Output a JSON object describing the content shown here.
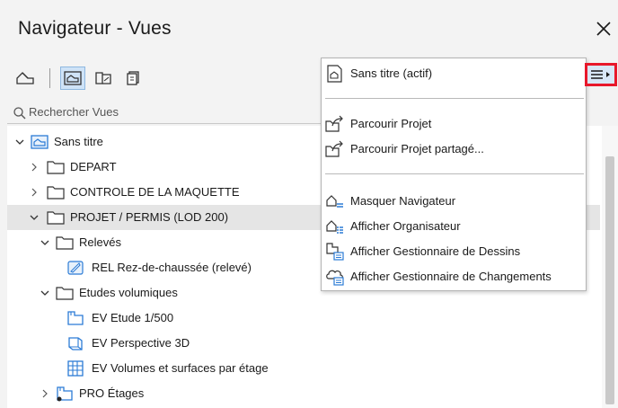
{
  "window": {
    "title": "Navigateur - Vues"
  },
  "search": {
    "placeholder": "Rechercher Vues"
  },
  "tree": [
    {
      "label": "Sans titre",
      "icon": "view-root-icon"
    },
    {
      "label": "DEPART",
      "icon": "folder-icon"
    },
    {
      "label": "CONTROLE DE LA MAQUETTE",
      "icon": "folder-icon"
    },
    {
      "label": "PROJET / PERMIS (LOD 200)",
      "icon": "folder-icon",
      "selected": true
    },
    {
      "label": "Relevés",
      "icon": "folder-icon"
    },
    {
      "label": "REL Rez-de-chaussée (relevé)",
      "icon": "elevation-view-icon"
    },
    {
      "label": "Etudes volumiques",
      "icon": "folder-icon"
    },
    {
      "label": "EV Etude 1/500",
      "icon": "story-view-icon"
    },
    {
      "label": "EV Perspective 3D",
      "icon": "3d-view-icon"
    },
    {
      "label": "EV Volumes et surfaces par étage",
      "icon": "schedule-view-icon"
    },
    {
      "label": "PRO Étages",
      "icon": "story-view-icon"
    }
  ],
  "menu": {
    "items": [
      {
        "label": "Sans titre (actif)",
        "icon": "project-map-icon"
      },
      {
        "label": "Parcourir Projet",
        "icon": "browse-project-icon"
      },
      {
        "label": "Parcourir Projet partagé...",
        "icon": "browse-shared-project-icon"
      },
      {
        "label": "Masquer Navigateur",
        "icon": "hide-navigator-icon"
      },
      {
        "label": "Afficher Organisateur",
        "icon": "organizer-icon"
      },
      {
        "label": "Afficher Gestionnaire de Dessins",
        "icon": "drawing-manager-icon"
      },
      {
        "label": "Afficher Gestionnaire de Changements",
        "icon": "change-manager-icon"
      }
    ]
  },
  "colors": {
    "accent": "#2b7bd6",
    "selection": "#e5e5e5",
    "highlight_border": "#e8182b"
  }
}
